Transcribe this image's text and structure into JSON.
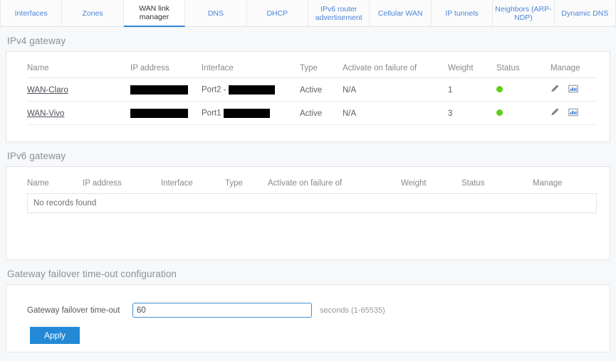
{
  "tabs": [
    {
      "label": "Interfaces",
      "active": false
    },
    {
      "label": "Zones",
      "active": false
    },
    {
      "label": "WAN link manager",
      "active": true
    },
    {
      "label": "DNS",
      "active": false
    },
    {
      "label": "DHCP",
      "active": false
    },
    {
      "label": "IPv6 router advertisement",
      "active": false
    },
    {
      "label": "Cellular WAN",
      "active": false
    },
    {
      "label": "IP tunnels",
      "active": false
    },
    {
      "label": "Neighbors (ARP-NDP)",
      "active": false
    },
    {
      "label": "Dynamic DNS",
      "active": false
    }
  ],
  "ipv4": {
    "title": "IPv4 gateway",
    "columns": [
      "Name",
      "IP address",
      "Interface",
      "Type",
      "Activate on failure of",
      "Weight",
      "Status",
      "Manage"
    ],
    "rows": [
      {
        "name": "WAN-Claro",
        "ip_address": "",
        "ip_redacted": true,
        "interface": "Port2 -",
        "interface_redacted": true,
        "type": "Active",
        "activate_on_failure_of": "N/A",
        "weight": "1",
        "status": "up",
        "status_color": "#5dcf16",
        "manage": [
          "edit-icon",
          "statistics-icon"
        ]
      },
      {
        "name": "WAN-Vivo",
        "ip_address": "",
        "ip_redacted": true,
        "interface": "Port1",
        "interface_redacted": true,
        "type": "Active",
        "activate_on_failure_of": "N/A",
        "weight": "3",
        "status": "up",
        "status_color": "#5dcf16",
        "manage": [
          "edit-icon",
          "statistics-icon"
        ]
      }
    ]
  },
  "ipv6": {
    "title": "IPv6 gateway",
    "columns": [
      "Name",
      "IP address",
      "Interface",
      "Type",
      "Activate on failure of",
      "Weight",
      "Status",
      "Manage"
    ],
    "empty_message": "No records found"
  },
  "failover": {
    "title": "Gateway failover time-out configuration",
    "label": "Gateway failover time-out",
    "value": "60",
    "placeholder": "",
    "hint": "seconds (1-65535)",
    "apply_label": "Apply"
  },
  "colors": {
    "accent": "#2389d6",
    "tab_link": "#4a85d6",
    "status_up": "#5dcf16"
  }
}
